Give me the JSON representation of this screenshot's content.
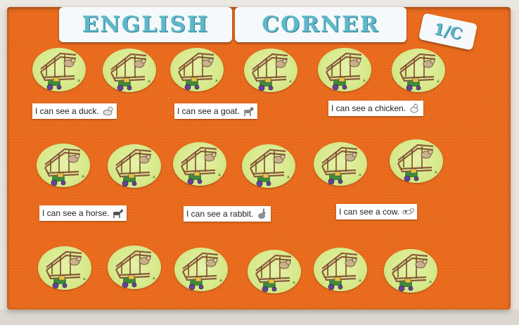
{
  "banner": {
    "left_text": "ENGLISH",
    "right_text": "CORNER",
    "class_tag": "1/C"
  },
  "captions": [
    {
      "text": "I can see a duck.",
      "icon": "duck-icon"
    },
    {
      "text": "I can see a goat.",
      "icon": "goat-icon"
    },
    {
      "text": "I can see a chicken.",
      "icon": "chicken-icon"
    },
    {
      "text": "I can see a horse.",
      "icon": "horse-icon"
    },
    {
      "text": "I can see a rabbit.",
      "icon": "rabbit-icon"
    },
    {
      "text": "I can see a cow.",
      "icon": "cow-icon"
    }
  ],
  "colors": {
    "board": "#ea6a1c",
    "banner_text": "#5fb7c9",
    "disc": "#d7e98b"
  }
}
